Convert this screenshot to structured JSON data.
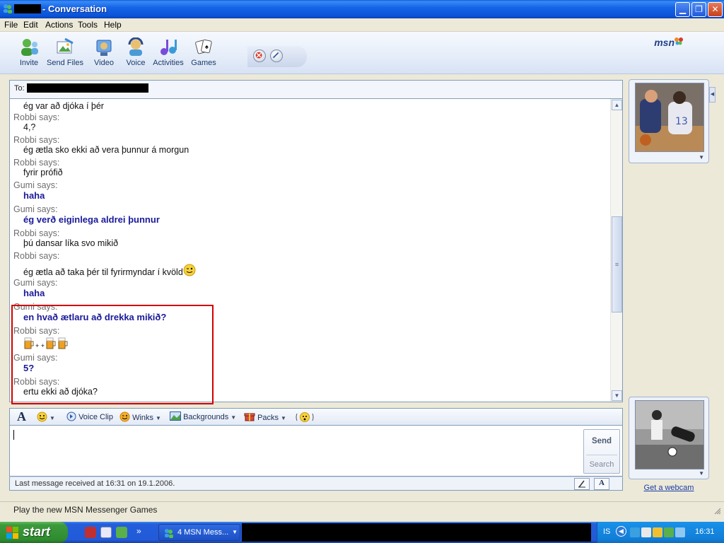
{
  "window": {
    "title": "- Conversation"
  },
  "menu": [
    "File",
    "Edit",
    "Actions",
    "Tools",
    "Help"
  ],
  "toolbar": {
    "buttons": [
      {
        "label": "Invite",
        "icon": "invite-icon"
      },
      {
        "label": "Send Files",
        "icon": "send-files-icon"
      },
      {
        "label": "Video",
        "icon": "video-icon"
      },
      {
        "label": "Voice",
        "icon": "voice-icon"
      },
      {
        "label": "Activities",
        "icon": "activities-icon"
      },
      {
        "label": "Games",
        "icon": "games-icon"
      }
    ],
    "logo": "msn"
  },
  "to_label": "To:",
  "history": {
    "top_partial": "ég var að djóka í þér",
    "messages": [
      {
        "sender": "Robbi says:",
        "text": "4,?"
      },
      {
        "sender": "Robbi says:",
        "text": "ég ætla sko ekki að vera þunnur á morgun"
      },
      {
        "sender": "Robbi says:",
        "text": "fyrir prófið"
      },
      {
        "sender": "Gumi says:",
        "text": "haha"
      },
      {
        "sender": "Gumi says:",
        "text": "ég verð eiginlega aldrei þunnur"
      },
      {
        "sender": "Robbi says:",
        "text": "þú dansar líka svo mikið"
      },
      {
        "sender": "Robbi says:",
        "text": "ég ætla að taka þér til fyrirmyndar í kvöld"
      },
      {
        "sender": "Gumi says:",
        "text": "haha"
      },
      {
        "sender": "Gumi says:",
        "text": "en hvað ætlaru að drekka mikið?"
      },
      {
        "sender": "Robbi says:",
        "text": "+ +"
      },
      {
        "sender": "Gumi says:",
        "text": "5?"
      },
      {
        "sender": "Robbi says:",
        "text": "ertu ekki að djóka?"
      }
    ]
  },
  "format_bar": {
    "font": "A",
    "voice_clip": "Voice Clip",
    "winks": "Winks",
    "backgrounds": "Backgrounds",
    "packs": "Packs"
  },
  "compose": {
    "send": "Send",
    "search": "Search"
  },
  "status": {
    "last_message": "Last message received at 16:31 on 19.1.2006."
  },
  "sidebar": {
    "webcam_link": "Get a webcam"
  },
  "banner": {
    "text": "Play the new MSN Messenger Games"
  },
  "taskbar": {
    "start": "start",
    "task_label": "4 MSN Mess...",
    "lang": "IS",
    "clock": "16:31"
  },
  "colors": {
    "title_blue": "#0a52d6",
    "gumi_text": "#1a1a9a",
    "highlight": "#d40000",
    "start_green": "#3c9a3c"
  }
}
